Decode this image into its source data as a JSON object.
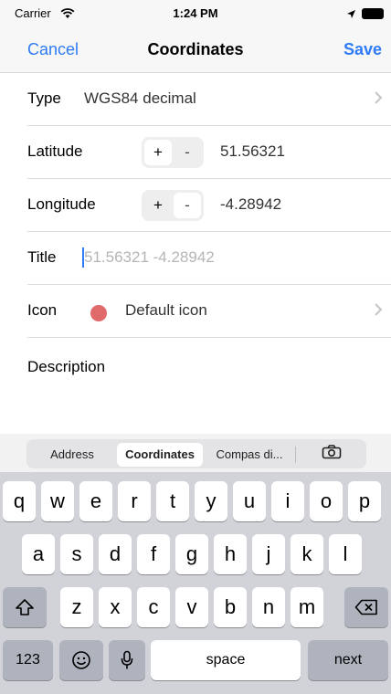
{
  "status_bar": {
    "carrier": "Carrier",
    "time": "1:24 PM"
  },
  "nav": {
    "cancel": "Cancel",
    "title": "Coordinates",
    "save": "Save"
  },
  "form": {
    "type": {
      "label": "Type",
      "value": "WGS84 decimal"
    },
    "latitude": {
      "label": "Latitude",
      "plus": "+",
      "minus": "-",
      "value": "51.56321"
    },
    "longitude": {
      "label": "Longitude",
      "plus": "+",
      "minus": "-",
      "value": "-4.28942"
    },
    "title": {
      "label": "Title",
      "placeholder": "51.56321 -4.28942"
    },
    "icon": {
      "label": "Icon",
      "value": "Default icon",
      "color": "#e06a6a"
    },
    "description": {
      "label": "Description"
    }
  },
  "segments": {
    "address": "Address",
    "coordinates": "Coordinates",
    "compass": "Compas di...",
    "camera_icon": "camera-icon"
  },
  "keyboard": {
    "row1": [
      "q",
      "w",
      "e",
      "r",
      "t",
      "y",
      "u",
      "i",
      "o",
      "p"
    ],
    "row2": [
      "a",
      "s",
      "d",
      "f",
      "g",
      "h",
      "j",
      "k",
      "l"
    ],
    "row3": [
      "z",
      "x",
      "c",
      "v",
      "b",
      "n",
      "m"
    ],
    "numbers": "123",
    "space": "space",
    "next": "next"
  },
  "colors": {
    "accent": "#2f7bf5",
    "icon_red": "#e06a6a"
  }
}
